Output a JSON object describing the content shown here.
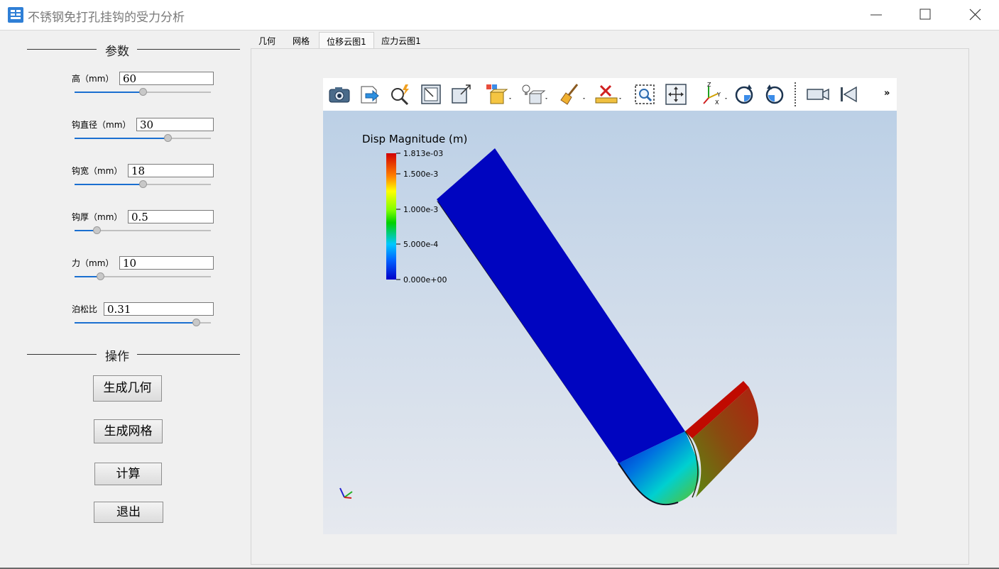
{
  "window": {
    "title": "不锈钢免打孔挂钩的受力分析"
  },
  "params": {
    "section_title": "参数",
    "height": {
      "label": "高（mm）",
      "value": "60",
      "slider": 0.5
    },
    "hook_diameter": {
      "label": "钩直径（mm）",
      "value": "30",
      "slider": 0.68
    },
    "hook_width": {
      "label": "钩宽（mm）",
      "value": "18",
      "slider": 0.5
    },
    "hook_thickness": {
      "label": "钩厚（mm）",
      "value": "0.5",
      "slider": 0.16
    },
    "force": {
      "label": "力（mm）",
      "value": "10",
      "slider": 0.19
    },
    "poisson": {
      "label": "泊松比",
      "value": "0.31",
      "slider": 0.89
    }
  },
  "actions": {
    "section_title": "操作",
    "generate_geometry": "生成几何",
    "generate_mesh": "生成网格",
    "compute": "计算",
    "exit": "退出"
  },
  "tabs": [
    "几何",
    "网格",
    "位移云图1",
    "应力云图1"
  ],
  "active_tab": "位移云图1",
  "toolbar": {
    "tools": [
      "camera-icon",
      "export-icon",
      "find-data-icon",
      "reset-camera-icon",
      "zoom-data-icon",
      "color-by-icon",
      "light-icon",
      "clear-icon",
      "ruler-icon",
      "zoom-box-icon",
      "interact-icon",
      "axes-orientation-icon",
      "rotate-cw-icon",
      "rotate-ccw-icon",
      "camera-view-icon",
      "first-frame-icon",
      "more-icon"
    ],
    "overflow_label": "»"
  },
  "legend": {
    "title": "Disp Magnitude (m)",
    "ticks": [
      "1.813e-03",
      "1.500e-3",
      "1.000e-3",
      "5.000e-4",
      "0.000e+00"
    ],
    "colors": [
      "#d10000",
      "#ffff00",
      "#00d000",
      "#00c8ff",
      "#0000c8"
    ]
  },
  "colors": {
    "accent": "#1a6fd0",
    "model_blue": "#0005c0",
    "model_red": "#c00a00"
  }
}
